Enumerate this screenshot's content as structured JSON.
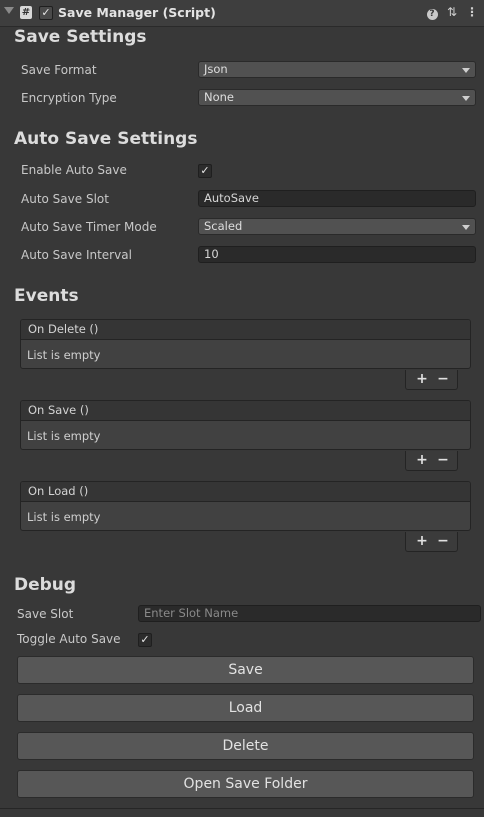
{
  "header": {
    "title": "Save Manager (Script)",
    "script_icon": "#",
    "enabled_check": "✓",
    "icons": [
      "help-icon",
      "presets-icon",
      "context-menu-icon"
    ]
  },
  "save_settings": {
    "title": "Save Settings",
    "save_format_label": "Save Format",
    "save_format_value": "Json",
    "encryption_label": "Encryption Type",
    "encryption_value": "None"
  },
  "auto_save": {
    "title": "Auto Save Settings",
    "enable_label": "Enable Auto Save",
    "enable_check": "✓",
    "slot_label": "Auto Save Slot",
    "slot_value": "AutoSave",
    "timer_mode_label": "Auto Save Timer Mode",
    "timer_mode_value": "Scaled",
    "interval_label": "Auto Save Interval",
    "interval_value": "10"
  },
  "events": {
    "title": "Events",
    "items": [
      {
        "header": "On Delete ()",
        "body": "List is empty"
      },
      {
        "header": "On Save ()",
        "body": "List is empty"
      },
      {
        "header": "On Load ()",
        "body": "List is empty"
      }
    ],
    "plus": "+",
    "minus": "−"
  },
  "debug": {
    "title": "Debug",
    "slot_label": "Save Slot",
    "slot_placeholder": "Enter Slot Name",
    "toggle_label": "Toggle Auto Save",
    "toggle_check": "✓",
    "buttons": [
      "Save",
      "Load",
      "Delete",
      "Open Save Folder"
    ]
  },
  "colors": {
    "background": "#383838",
    "field": "#2a2a2a",
    "dropdown": "#515151",
    "button": "#575757"
  }
}
